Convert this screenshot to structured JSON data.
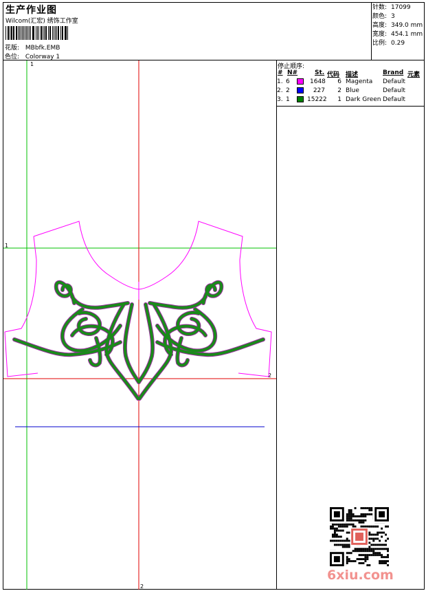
{
  "header": {
    "title": "生产作业图",
    "subtitle": "Wilcom(汇宏) 绣饰工作室",
    "design_label": "花版:",
    "design_value": "MBbfk.EMB",
    "colorway_label": "色位:",
    "colorway_value": "Colorway 1"
  },
  "stats": [
    {
      "label": "针数:",
      "value": "17099"
    },
    {
      "label": "颜色:",
      "value": "3"
    },
    {
      "label": "高度:",
      "value": "349.0 mm"
    },
    {
      "label": "宽度:",
      "value": "454.1 mm"
    },
    {
      "label": "比例:",
      "value": "0.29"
    }
  ],
  "stop_sequence": {
    "title": "停止顺序:",
    "columns": [
      "#",
      "N#",
      "St.",
      "代码",
      "描述",
      "Brand",
      "元素"
    ],
    "rows": [
      {
        "num": "1.",
        "n": "6",
        "color": "#ff00ff",
        "st": "1648",
        "code": "6",
        "desc": "Magenta",
        "brand": "Default",
        "element": ""
      },
      {
        "num": "2.",
        "n": "2",
        "color": "#0000ff",
        "st": "227",
        "code": "2",
        "desc": "Blue",
        "brand": "Default",
        "element": ""
      },
      {
        "num": "3.",
        "n": "1",
        "color": "#008000",
        "st": "15222",
        "code": "1",
        "desc": "Dark Green",
        "brand": "Default",
        "element": ""
      }
    ]
  },
  "guides": {
    "markers": [
      "1",
      "1",
      "2",
      "2"
    ],
    "colors": {
      "vertical": "#00c000",
      "horizontal_top": "#00c000",
      "center": "#e00000",
      "horizontal_bottom": "#e00000",
      "blue_line": "#0000cc",
      "outline": "#ff00ff",
      "embroidery": "#1a8a1a",
      "underlay": "#9b30a0"
    }
  },
  "watermark": {
    "text": "6xiu.com",
    "color": "#f2928f"
  }
}
